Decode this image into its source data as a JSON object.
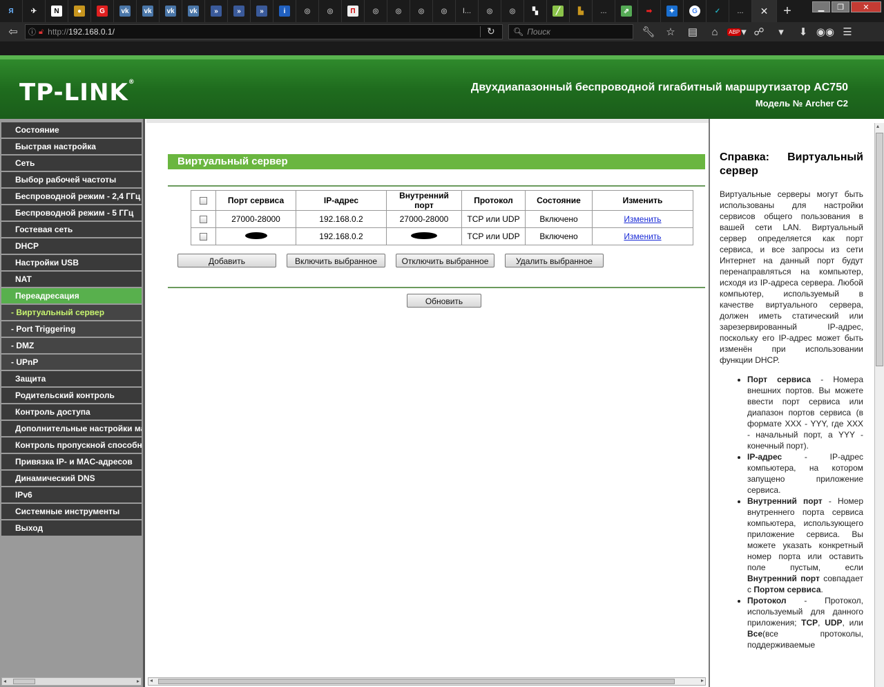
{
  "browser": {
    "url_prefix": "http://",
    "url_host": "192.168.0.1/",
    "search_placeholder": "Поиск",
    "tab_overflow_1": "...",
    "tab_overflow_2": "...",
    "tab_overflow_3": "...",
    "tab_text_label": "I..."
  },
  "header": {
    "logo": "TP-LINK",
    "logo_mark": "®",
    "title": "Двухдиапазонный беспроводной гигабитный маршрутизатор AC750",
    "model": "Модель № Archer C2"
  },
  "menu": [
    {
      "label": "Состояние",
      "type": "item"
    },
    {
      "label": "Быстрая настройка",
      "type": "item"
    },
    {
      "label": "Сеть",
      "type": "item"
    },
    {
      "label": "Выбор рабочей частоты",
      "type": "item"
    },
    {
      "label": "Беспроводной режим - 2,4 ГГц",
      "type": "item"
    },
    {
      "label": "Беспроводной режим - 5 ГГц",
      "type": "item"
    },
    {
      "label": "Гостевая сеть",
      "type": "item"
    },
    {
      "label": "DHCP",
      "type": "item"
    },
    {
      "label": "Настройки USB",
      "type": "item"
    },
    {
      "label": "NAT",
      "type": "item"
    },
    {
      "label": "Переадресация",
      "type": "selected"
    },
    {
      "label": "- Виртуальный сервер",
      "type": "sub-current"
    },
    {
      "label": "- Port Triggering",
      "type": "sub"
    },
    {
      "label": "- DMZ",
      "type": "sub"
    },
    {
      "label": "- UPnP",
      "type": "sub"
    },
    {
      "label": "Защита",
      "type": "item"
    },
    {
      "label": "Родительский контроль",
      "type": "item"
    },
    {
      "label": "Контроль доступа",
      "type": "item"
    },
    {
      "label": "Дополнительные настройки маршрутизации",
      "type": "item"
    },
    {
      "label": "Контроль пропускной способности",
      "type": "item"
    },
    {
      "label": "Привязка IP- и MAC-адресов",
      "type": "item"
    },
    {
      "label": "Динамический DNS",
      "type": "item"
    },
    {
      "label": "IPv6",
      "type": "item"
    },
    {
      "label": "Системные инструменты",
      "type": "item"
    },
    {
      "label": "Выход",
      "type": "item"
    }
  ],
  "main": {
    "section_title": "Виртуальный сервер",
    "table": {
      "headers": [
        "Порт сервиса",
        "IP-адрес",
        "Внутренний порт",
        "Протокол",
        "Состояние",
        "Изменить"
      ],
      "rows": [
        {
          "service_port": "27000-28000",
          "ip": "192.168.0.2",
          "internal_port": "27000-28000",
          "protocol": "TCP или UDP",
          "status": "Включено",
          "edit": "Изменить"
        },
        {
          "service_port": "",
          "ip": "192.168.0.2",
          "internal_port": "",
          "protocol": "TCP или UDP",
          "status": "Включено",
          "edit": "Изменить"
        }
      ]
    },
    "buttons": {
      "add": "Добавить",
      "enable_selected": "Включить выбранное",
      "disable_selected": "Отключить выбранное",
      "delete_selected": "Удалить выбранное",
      "refresh": "Обновить"
    }
  },
  "help": {
    "title": "Справка: Виртуальный сервер",
    "intro": "Виртуальные серверы могут быть использованы для настройки сервисов общего пользования в вашей сети LAN. Виртуальный сервер определяется как порт сервиса, и все запросы из сети Интернет на данный порт будут перенаправляться на компьютер, исходя из IP-адреса сервера. Любой компьютер, используемый в качестве виртуального сервера, должен иметь статический или зарезервированный IP-адрес, поскольку его IP-адрес может быть изменён при использовании функции DHCP.",
    "items": [
      {
        "term": "Порт сервиса",
        "text": " - Номера внешних портов. Вы можете ввести порт сервиса или диапазон портов сервиса (в формате XXX - YYY, где XXX - начальный порт, а YYY - конечный порт)."
      },
      {
        "term": "IP-адрес",
        "text": " - IP-адрес компьютера, на котором запущено приложение сервиса."
      },
      {
        "term": "Внутренний порт",
        "text": " - Номер внутреннего порта сервиса компьютера, использующего приложение сервиса. Вы можете указать конкретный номер порта или оставить поле пустым, если ",
        "t2": "Внутренний порт",
        "t3": " совпадает с ",
        "t4": "Портом сервиса",
        "t5": "."
      },
      {
        "term": "Протокол",
        "text": " - Протокол, используемый для данного приложения; ",
        "t2": "TCP",
        "t3": ", ",
        "t4": "UDP",
        "t5": ", или ",
        "t6": "Все",
        "t7": "(все протоколы, поддерживаемые"
      }
    ]
  },
  "colors": {
    "accent": "#58b04d",
    "header_green": "#1f6c1e",
    "link": "#1a2bd6"
  }
}
